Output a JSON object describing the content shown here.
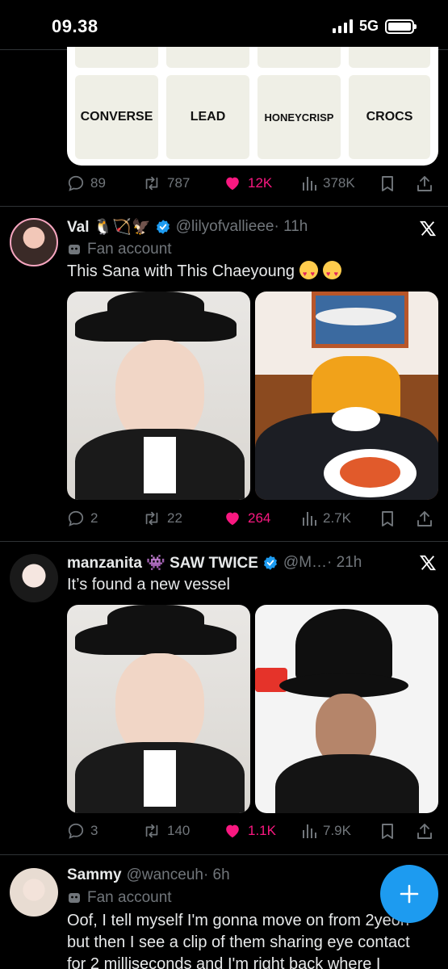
{
  "status": {
    "time": "09.38",
    "network": "5G"
  },
  "top_card": {
    "tiles": [
      "CONVERSE",
      "LEAD",
      "HONEYCRISP",
      "CROCS"
    ],
    "stats": {
      "replies": "89",
      "reposts": "787",
      "likes": "12K",
      "views": "378K"
    }
  },
  "tweets": [
    {
      "name": "Val 🐧🏹🦅",
      "handle": "@lilyofvallieee",
      "time": "· 11h",
      "label": "Fan account",
      "text": "This Sana with This Chaeyoung",
      "stats": {
        "replies": "2",
        "reposts": "22",
        "likes": "264",
        "views": "2.7K"
      }
    },
    {
      "name": "manzanita 👾 SAW TWICE",
      "handle": "@M…",
      "time": "· 21h",
      "text": "It’s found a new vessel",
      "stats": {
        "replies": "3",
        "reposts": "140",
        "likes": "1.1K",
        "views": "7.9K"
      }
    },
    {
      "name": "Sammy",
      "handle": "@wanceuh",
      "time": "· 6h",
      "label": "Fan account",
      "text_lines": [
        "Oof, I tell myself I'm gonna move on from 2yeon",
        "but then I see a clip of them sharing eye contact",
        "for 2 milliseconds and I'm right back where I"
      ]
    }
  ],
  "colors": {
    "accent": "#1d9bf0",
    "like": "#f91880",
    "muted": "#71767b"
  },
  "icons": [
    "reply-icon",
    "repost-icon",
    "like-icon",
    "views-icon",
    "bookmark-icon",
    "share-icon",
    "x-logo-icon",
    "verified-icon",
    "mask-icon",
    "compose-icon"
  ]
}
